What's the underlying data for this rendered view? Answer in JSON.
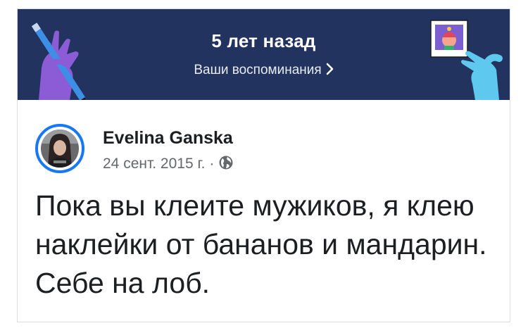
{
  "banner": {
    "title": "5 лет назад",
    "link_label": "Ваши воспоминания",
    "background_color": "#22335f"
  },
  "post": {
    "author": "Evelina Ganska",
    "date": "24 сент. 2015 г.",
    "separator": "·",
    "audience_icon": "globe-icon",
    "text": "Пока вы клеите мужиков, я клею наклейки от бананов и мандарин. Себе на лоб."
  },
  "colors": {
    "avatar_ring": "#1877f2",
    "text_primary": "#1c1e21",
    "text_secondary": "#65676b"
  }
}
